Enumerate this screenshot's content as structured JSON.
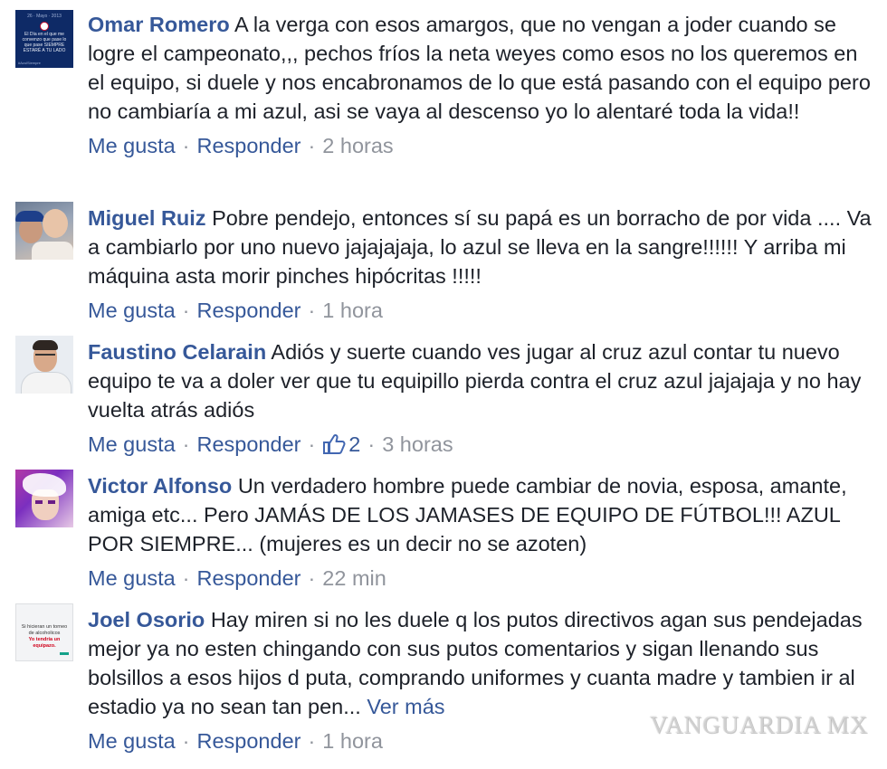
{
  "labels": {
    "like": "Me gusta",
    "reply": "Responder",
    "separator": "·",
    "see_more": "Ver más"
  },
  "comments": [
    {
      "author": "Omar Romero",
      "text": "A la verga con esos amargos, que no vengan a joder cuando se logre el campeonato,,, pechos fríos la neta weyes como esos no los queremos en el equipo, si duele y nos encabronamos de lo que está pasando con el equipo pero no cambiaría a mi azul, asi se vaya al descenso yo lo alentaré toda la vida!!",
      "time": "2 horas",
      "avatar": {
        "date": "26 · Mayo · 2013",
        "message": "El Día en el que me convenzo que pase lo que pase SIEMPRE ESTARÉ A TU LADO",
        "tag": "#AzulSiempre"
      }
    },
    {
      "author": "Miguel Ruiz",
      "text": "Pobre pendejo, entonces sí su papá es un borracho de por vida .... Va a cambiarlo por uno nuevo jajajajaja, lo azul se lleva en la sangre!!!!!! Y arriba mi máquina asta morir pinches hipócritas !!!!!",
      "time": "1 hora"
    },
    {
      "author": "Faustino Celarain",
      "text": "Adiós y suerte cuando ves jugar al cruz azul contar tu nuevo equipo te va a doler ver que tu equipillo pierda contra el cruz azul jajajaja y no hay vuelta atrás adiós",
      "likes": "2",
      "time": "3 horas"
    },
    {
      "author": "Victor Alfonso",
      "text": "Un verdadero hombre puede cambiar de novia, esposa, amante, amiga etc... Pero JAMÁS DE LOS JAMASES DE EQUIPO DE FÚTBOL!!! AZUL POR SIEMPRE... (mujeres es un decir no se azoten)",
      "time": "22 min"
    },
    {
      "author": "Joel Osorio",
      "text": "Hay miren si no les duele q los putos directivos agan sus pendejadas mejor ya no esten chingando con sus putos comentarios y sigan llenando sus bolsillos a esos hijos d puta, comprando uniformes y cuanta madre y tambien ir al estadio ya no sean tan pen...",
      "time": "1 hora",
      "avatar": {
        "line1": "Si hicieran un torneo de alcoholicos",
        "line2": "Yo tendría un equipazo."
      }
    }
  ],
  "watermark": "VANGUARDIA MX",
  "colors": {
    "link": "#365899",
    "text": "#1d2129",
    "meta": "#90949c"
  }
}
